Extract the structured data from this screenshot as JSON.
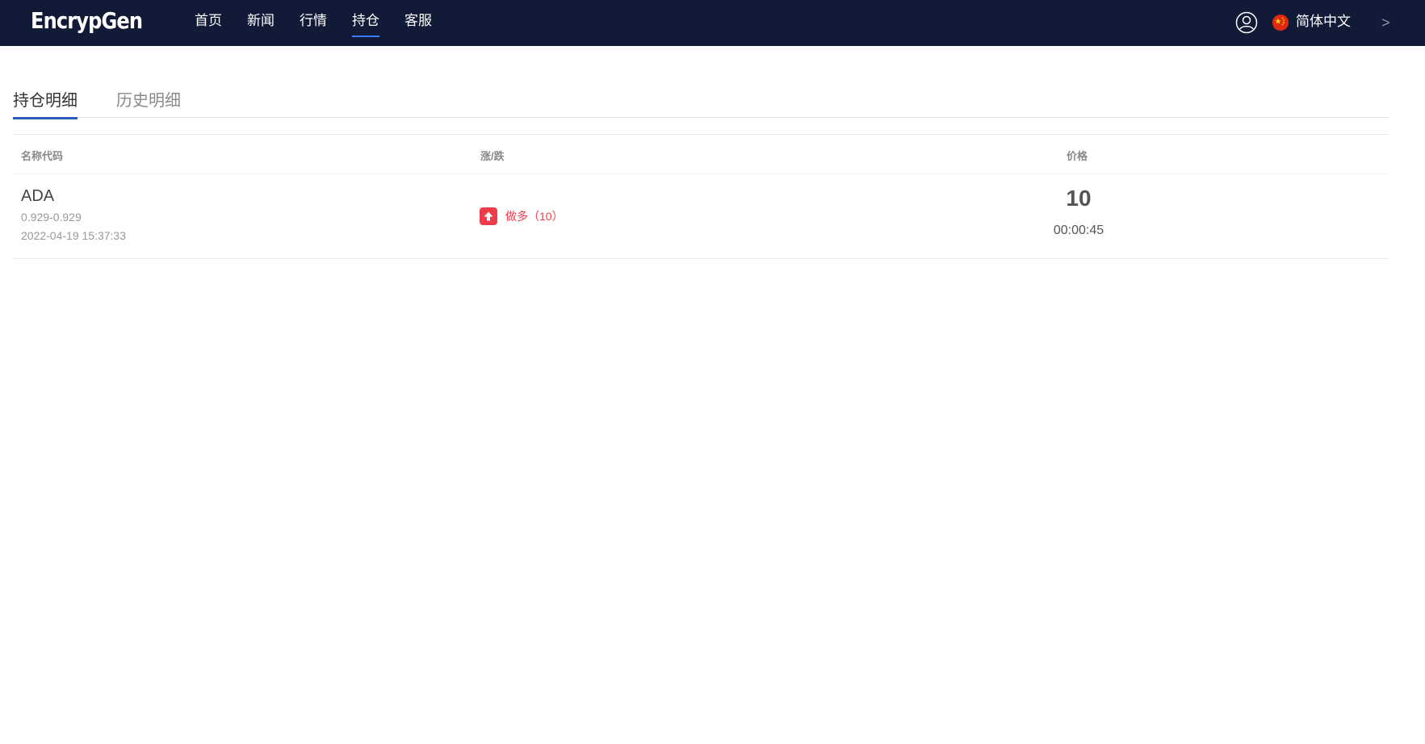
{
  "header": {
    "logo": "EncrypGen",
    "nav": [
      {
        "label": "首页",
        "active": false
      },
      {
        "label": "新闻",
        "active": false
      },
      {
        "label": "行情",
        "active": false
      },
      {
        "label": "持仓",
        "active": true
      },
      {
        "label": "客服",
        "active": false
      }
    ],
    "user_icon": "user-icon",
    "flag_icon": "china-flag-icon",
    "language": "简体中文",
    "more_icon": ">"
  },
  "tabs": [
    {
      "label": "持仓明细",
      "active": true
    },
    {
      "label": "历史明细",
      "active": false
    }
  ],
  "table": {
    "headers": {
      "name": "名称代码",
      "change": "涨/跌",
      "price": "价格"
    },
    "rows": [
      {
        "symbol": "ADA",
        "range": "0.929-0.929",
        "time": "2022-04-19 15:37:33",
        "direction_icon": "arrow-up-icon",
        "direction": "做多（10）",
        "price": "10",
        "countdown": "00:00:45"
      }
    ]
  },
  "colors": {
    "header_bg": "#111a37",
    "active_accent": "#3b7bff",
    "tab_accent": "#2f5bb8",
    "long_red": "#ef3c4a"
  }
}
